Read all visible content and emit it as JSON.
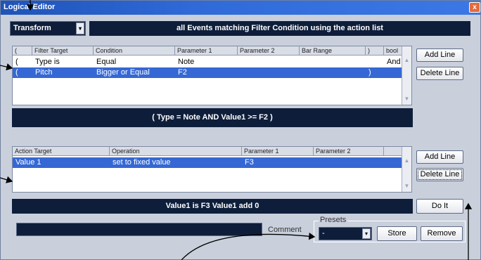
{
  "window": {
    "title": "Logical Editor",
    "close_glyph": "x"
  },
  "mode": {
    "selected": "Transform",
    "arrow": "▾"
  },
  "banner": "all Events matching Filter Condition using the action list",
  "filter": {
    "headers": [
      "(",
      "Filter Target",
      "Condition",
      "Parameter 1",
      "Parameter 2",
      "Bar Range",
      ")",
      "bool"
    ],
    "rows": [
      [
        "(",
        "Type is",
        "Equal",
        "Note",
        "",
        "",
        "",
        "And"
      ],
      [
        "(",
        "Pitch",
        "Bigger or Equal",
        "F2",
        "",
        "",
        ")",
        ""
      ]
    ],
    "selected_row": 1,
    "expression": "(   Type = Note  AND   Value1 >= F2   )"
  },
  "action": {
    "headers": [
      "Action Target",
      "Operation",
      "Parameter 1",
      "Parameter 2"
    ],
    "rows": [
      [
        "Value 1",
        "set to fixed value",
        "F3",
        ""
      ]
    ],
    "selected_row": 0,
    "expression": "Value1 is F3    Value1 add 0"
  },
  "buttons": {
    "add_line": "Add Line",
    "delete_line": "Delete Line",
    "add_line_2": "Add Line",
    "delete_line_2": "Delete Line",
    "do_it": "Do It",
    "store": "Store",
    "remove": "Remove"
  },
  "comment": {
    "label": "Comment",
    "value": ""
  },
  "presets": {
    "label": "Presets",
    "selected": "-",
    "arrow": "▾"
  },
  "scroll_glyphs": {
    "up": "▲",
    "down": "▼"
  },
  "colors": {
    "panel": "#c9d0dc",
    "dark": "#0e1e3a",
    "selection": "#3568d4",
    "titlebar": "#2f6ad8"
  }
}
